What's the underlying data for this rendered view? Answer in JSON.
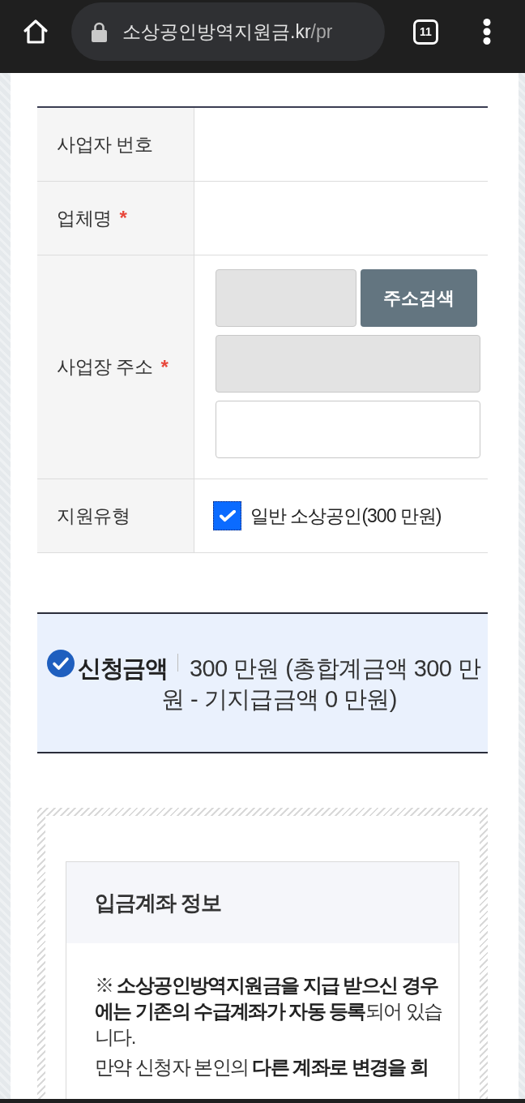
{
  "browser": {
    "url_host": "소상공인방역지원금.kr",
    "url_path": "/pr",
    "tab_count": "11"
  },
  "section": {
    "required_mark": "*",
    "rows": [
      {
        "kind": "blank",
        "label": "사업자 번호",
        "required": false
      },
      {
        "kind": "blank",
        "label": "업체명",
        "required": true
      },
      {
        "kind": "address",
        "label": "사업장 주소",
        "required": true,
        "button": "주소검색",
        "fields": [
          {
            "disabled": true
          },
          {
            "disabled": true
          },
          {
            "disabled": false
          }
        ]
      },
      {
        "kind": "checkbox",
        "label": "지원유형",
        "required": false,
        "options": [
          {
            "label": "일반 소상공인(300 만원)",
            "checked": true,
            "focused": true
          }
        ]
      }
    ]
  },
  "summary": {
    "label": "신청금액",
    "value": "300 만원 (총합계금액 300 만원 - 기지급금액 0 만원)"
  },
  "account_info": {
    "title": "입금계좌 정보",
    "paragraphs": [
      "※ **소상공인방역지원금을 지급 받으신 경우에는 기존의 수급계좌가 자동 등록**되어 있습니다.",
      "만약 신청자 본인의 **다른 계좌로 변경을 희**"
    ]
  }
}
